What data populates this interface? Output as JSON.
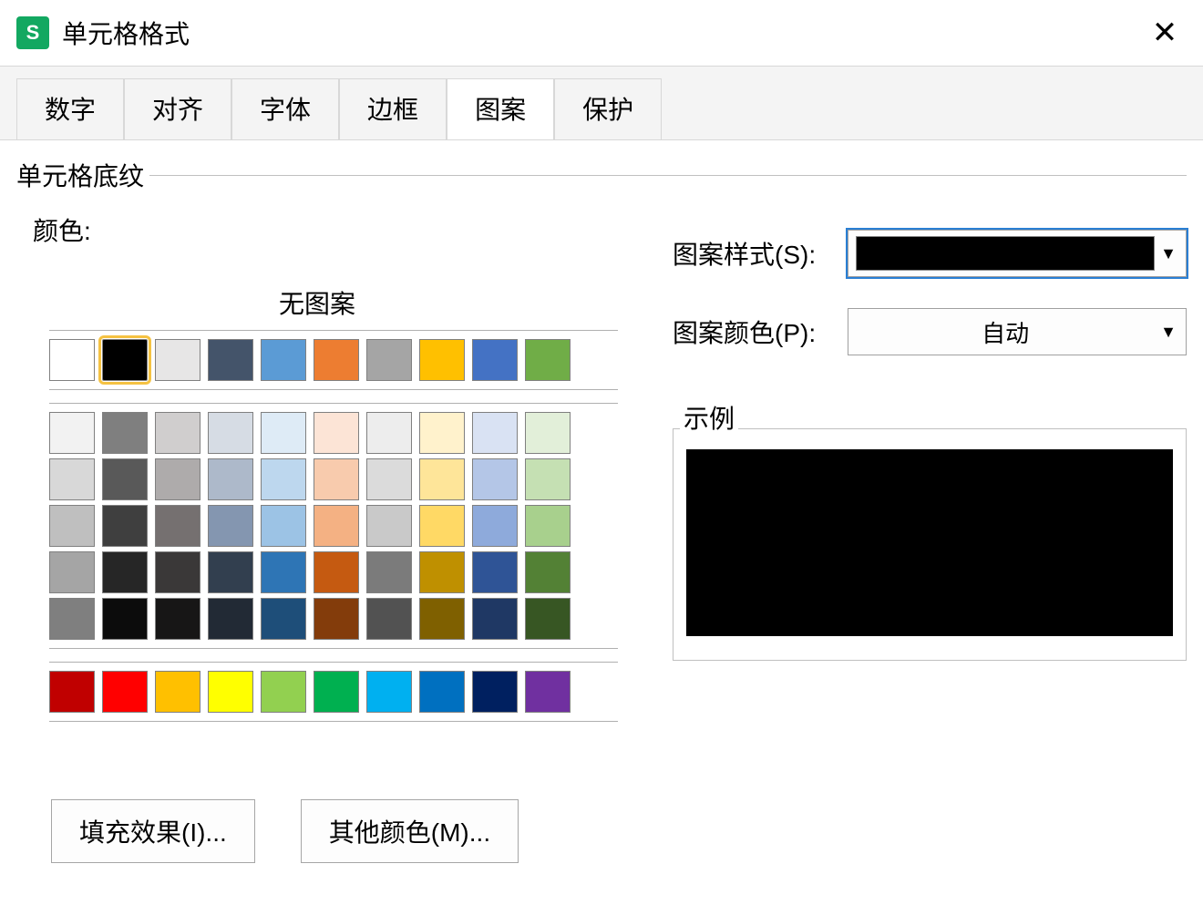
{
  "titlebar": {
    "app_icon_letter": "S",
    "title": "单元格格式",
    "close_glyph": "✕"
  },
  "tabs": [
    {
      "label": "数字",
      "active": false
    },
    {
      "label": "对齐",
      "active": false
    },
    {
      "label": "字体",
      "active": false
    },
    {
      "label": "边框",
      "active": false
    },
    {
      "label": "图案",
      "active": true
    },
    {
      "label": "保护",
      "active": false
    }
  ],
  "section": {
    "shading_title": "单元格底纹",
    "color_label": "颜色:",
    "no_pattern_label": "无图案",
    "pattern_style_label": "图案样式(S):",
    "pattern_color_label": "图案颜色(P):",
    "pattern_color_value": "自动",
    "sample_label": "示例",
    "dropdown_arrow": "▼"
  },
  "palette": {
    "selected_index": 1,
    "row1": [
      "#ffffff",
      "#000000",
      "#e7e6e6",
      "#44546a",
      "#5b9bd5",
      "#ed7d31",
      "#a5a5a5",
      "#ffc000",
      "#4472c4",
      "#70ad47"
    ],
    "theme_rows": [
      [
        "#f2f2f2",
        "#7f7f7f",
        "#d0cece",
        "#d6dce4",
        "#deebf6",
        "#fce4d6",
        "#ededed",
        "#fff2cc",
        "#d9e2f3",
        "#e2efd9"
      ],
      [
        "#d8d8d8",
        "#595959",
        "#aeabab",
        "#adb9ca",
        "#bdd7ee",
        "#f8cbad",
        "#dbdbdb",
        "#fee599",
        "#b4c6e7",
        "#c5e0b3"
      ],
      [
        "#bfbfbf",
        "#3f3f3f",
        "#757070",
        "#8496b0",
        "#9cc3e5",
        "#f4b183",
        "#c9c9c9",
        "#ffd965",
        "#8eaadb",
        "#a8d08d"
      ],
      [
        "#a5a5a5",
        "#262626",
        "#3a3838",
        "#323f4f",
        "#2e75b5",
        "#c55a11",
        "#7b7b7b",
        "#bf9000",
        "#2f5496",
        "#538135"
      ],
      [
        "#7f7f7f",
        "#0c0c0c",
        "#171616",
        "#222a35",
        "#1e4e79",
        "#833c0b",
        "#525252",
        "#7f6000",
        "#1f3864",
        "#375623"
      ]
    ],
    "standard_row": [
      "#c00000",
      "#ff0000",
      "#ffc000",
      "#ffff00",
      "#92d050",
      "#00b050",
      "#00b0f0",
      "#0070c0",
      "#002060",
      "#7030a0"
    ]
  },
  "buttons": {
    "fill_effects": "填充效果(I)...",
    "more_colors": "其他颜色(M)..."
  },
  "sample": {
    "color": "#000000"
  }
}
